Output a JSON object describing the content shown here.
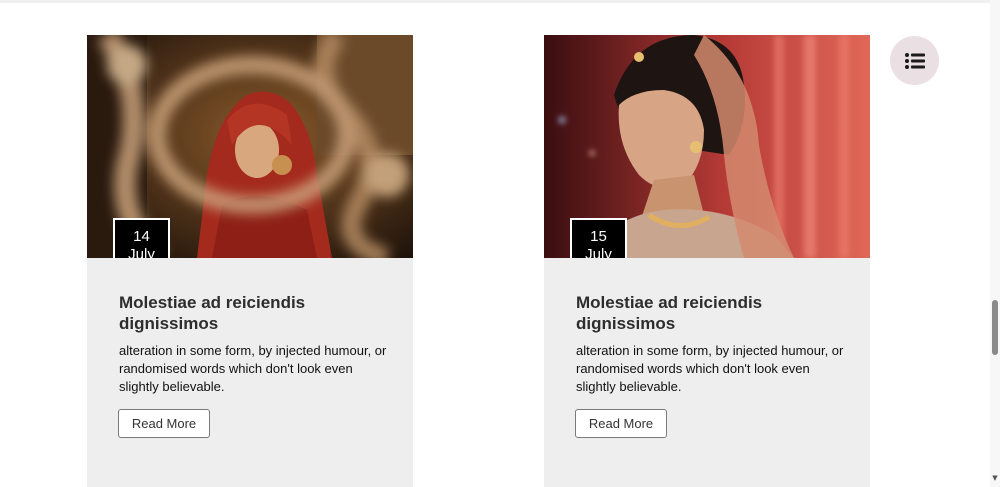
{
  "cards": [
    {
      "date_day": "14",
      "date_month": "July",
      "title": "Molestiae ad reiciendis dignissimos",
      "text": "alteration in some form, by injected humour, or randomised words which don't look even slightly believable.",
      "button_label": "Read More"
    },
    {
      "date_day": "15",
      "date_month": "July",
      "title": "Molestiae ad reiciendis dignissimos",
      "text": "alteration in some form, by injected humour, or randomised words which don't look even slightly believable.",
      "button_label": "Read More"
    }
  ],
  "menu_button": {
    "icon": "list-icon"
  },
  "scrollbar": {
    "icon": "scroll-down-arrow-icon"
  },
  "colors": {
    "card_background": "#efeeef",
    "badge_background": "#000000",
    "fab_background": "#eadfe3"
  }
}
